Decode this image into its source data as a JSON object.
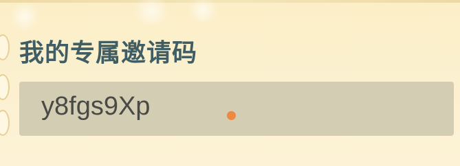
{
  "section": {
    "title": "我的专属邀请码"
  },
  "invite_code": {
    "value": "y8fgs9Xp"
  },
  "colors": {
    "title": "#3f5d63",
    "code_box_background": "#d3cdb4",
    "code_text": "#4a4a44",
    "cursor_marker": "#ec8a45",
    "panel_background": "#fbf0cf"
  }
}
